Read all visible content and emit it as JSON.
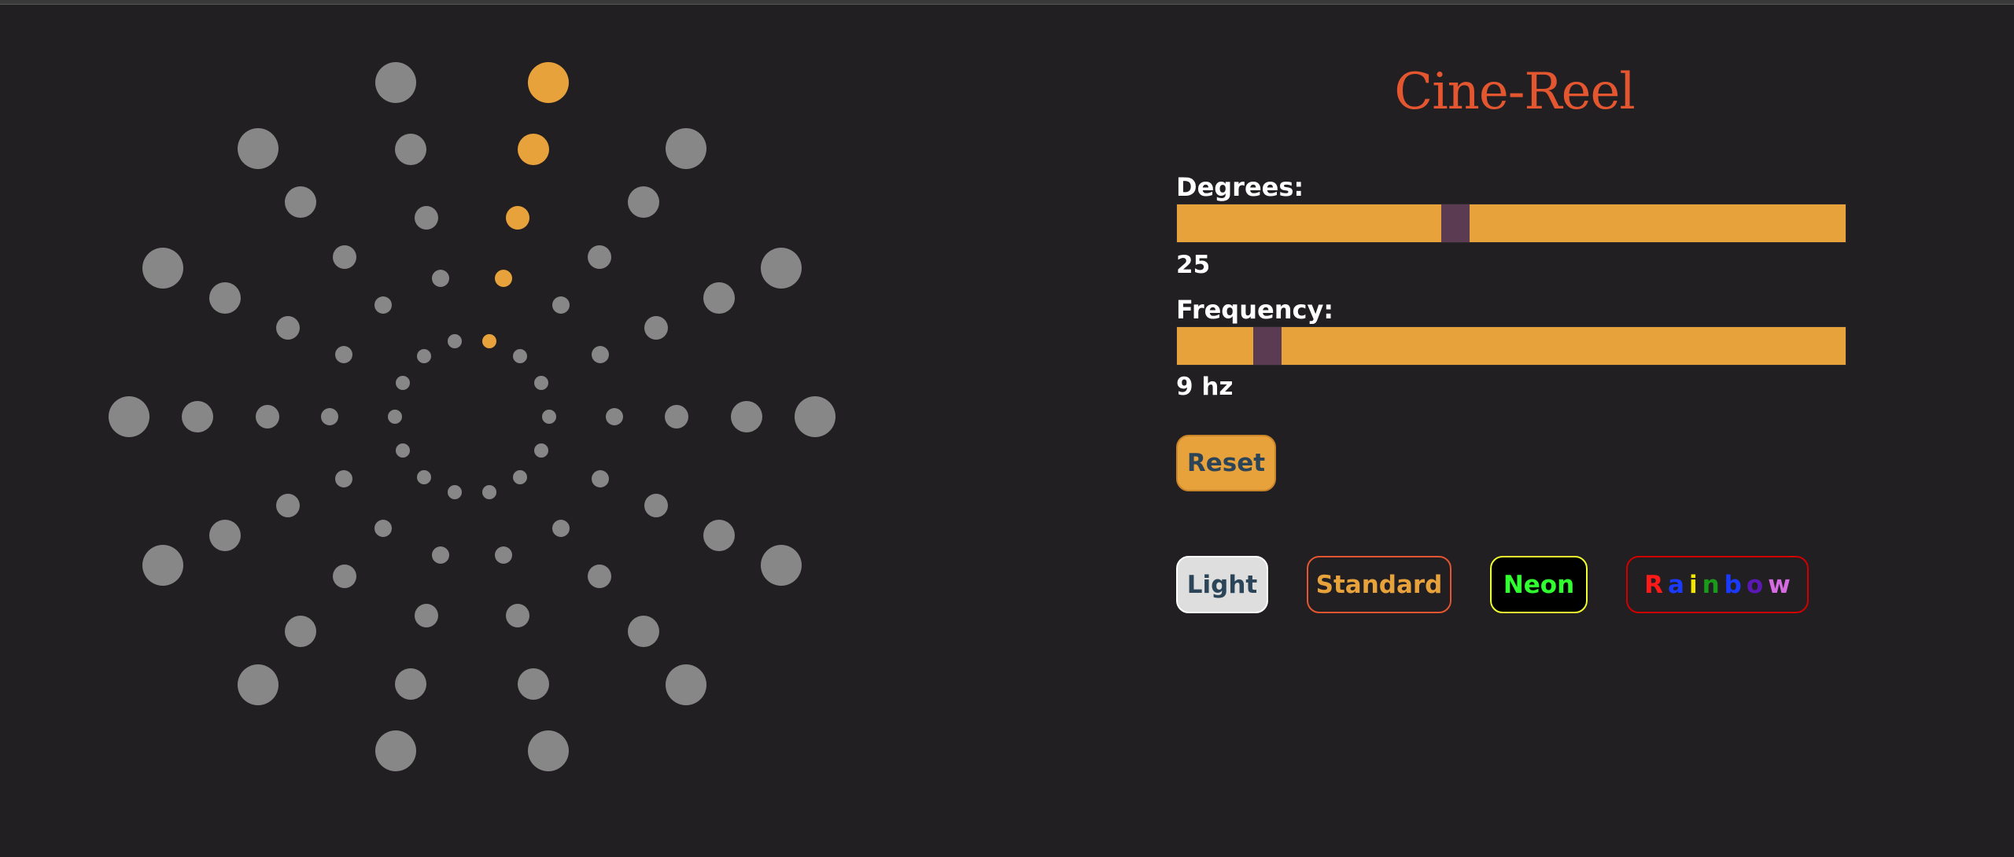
{
  "app": {
    "title": "Cine-Reel"
  },
  "controls": {
    "degrees": {
      "label": "Degrees:",
      "value": 25,
      "value_text": "25",
      "min": 0,
      "max": 60
    },
    "frequency": {
      "label": "Frequency:",
      "value": 9,
      "value_text": "9 hz",
      "min": 1,
      "max": 60
    },
    "reset_label": "Reset"
  },
  "themes": {
    "light": "Light",
    "standard": "Standard",
    "neon": "Neon",
    "rainbow": {
      "label": "Rainbow",
      "letters": [
        "R",
        "a",
        "i",
        "n",
        "b",
        "o",
        "w"
      ],
      "colors": [
        "#ff1a1a",
        "#1a3aff",
        "#f2e600",
        "#1a9a1a",
        "#1a3aff",
        "#5a18b5",
        "#d46be0"
      ]
    }
  },
  "colors": {
    "background": "#221f22",
    "accent": "#e8a23c",
    "title": "#e4562f",
    "dot_inactive": "#878787",
    "thumb": "#5a3b52"
  },
  "reel": {
    "spokes": 14,
    "rings": 5,
    "active_spoke": 1
  }
}
